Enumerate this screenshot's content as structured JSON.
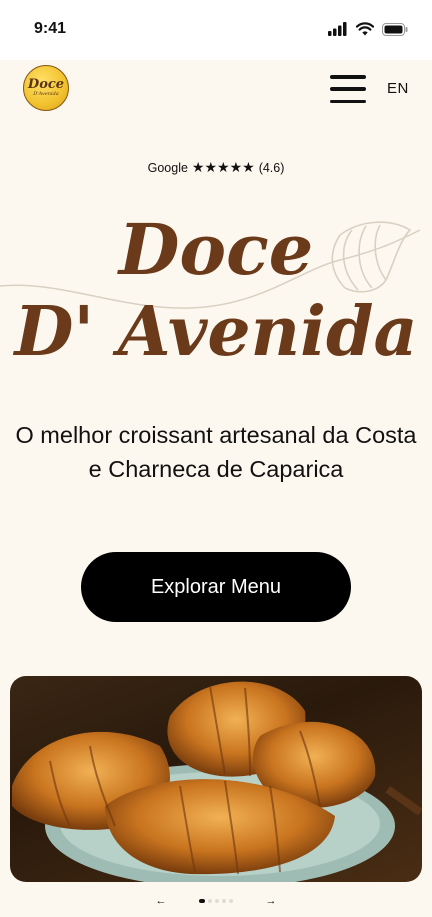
{
  "status_bar": {
    "time": "9:41"
  },
  "header": {
    "logo_text": "Doce",
    "logo_sub": "D'Avenida",
    "language": "EN"
  },
  "rating": {
    "source": "Google",
    "stars": "★★★★★",
    "score": "(4.6)"
  },
  "hero": {
    "title_line1": "Doce",
    "title_line2": "D' Avenida",
    "tagline": "O melhor croissant artesanal da Costa e Charneca de Caparica",
    "cta_label": "Explorar Menu"
  },
  "carousel": {
    "prev_arrow": "←",
    "next_arrow": "→",
    "slide_count": 5,
    "active_index": 0
  },
  "colors": {
    "background": "#fdf8ef",
    "brand_brown": "#6b3a1a",
    "cta_bg": "#000000"
  }
}
